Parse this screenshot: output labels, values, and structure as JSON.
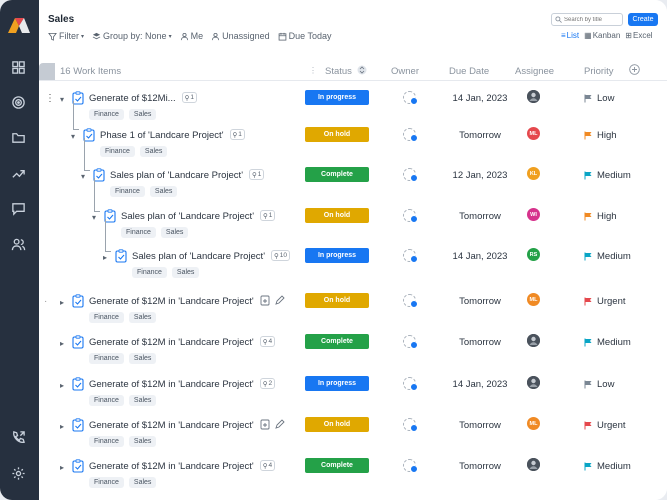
{
  "app": {
    "title": "Sales"
  },
  "toolbar": {
    "filter": "Filter",
    "group_by": "Group by: None",
    "me": "Me",
    "unassigned": "Unassigned",
    "due_today": "Due Today"
  },
  "search": {
    "placeholder": "Search by title"
  },
  "create_label": "Create",
  "views": {
    "list": "List",
    "kanban": "Kanban",
    "excel": "Excel"
  },
  "columns": {
    "work_items": "16 Work Items",
    "status": "Status",
    "owner": "Owner",
    "due_date": "Due Date",
    "assignee": "Assignee",
    "priority": "Priority"
  },
  "status_colors": {
    "In progress": "#1877f2",
    "On hold": "#e0a800",
    "Complete": "#24a148"
  },
  "priority_colors": {
    "Low": "#7b8794",
    "High": "#f08a24",
    "Medium": "#0aa5c5",
    "Urgent": "#e5484d"
  },
  "rows": [
    {
      "title": "Generate of $12Mi...",
      "subtasks": "1",
      "tags": [
        "Finance",
        "Sales"
      ],
      "status": "In progress",
      "due": "14 Jan, 2023",
      "assignee": {
        "initials": "",
        "color": "#3d4652",
        "photo": true
      },
      "priority": "Low"
    },
    {
      "title": "Phase 1 of 'Landcare Project'",
      "subtasks": "1",
      "tags": [
        "Finance",
        "Sales"
      ],
      "status": "On hold",
      "due": "Tomorrow",
      "assignee": {
        "initials": "ML",
        "color": "#e5484d"
      },
      "priority": "High"
    },
    {
      "title": "Sales plan of 'Landcare Project'",
      "subtasks": "1",
      "tags": [
        "Finance",
        "Sales"
      ],
      "status": "Complete",
      "due": "12 Jan, 2023",
      "assignee": {
        "initials": "KL",
        "color": "#f0a020"
      },
      "priority": "Medium"
    },
    {
      "title": "Sales plan of 'Landcare Project'",
      "subtasks": "1",
      "tags": [
        "Finance",
        "Sales"
      ],
      "status": "On hold",
      "due": "Tomorrow",
      "assignee": {
        "initials": "WI",
        "color": "#d6328c"
      },
      "priority": "High"
    },
    {
      "title": "Sales plan of 'Landcare Project'",
      "subtasks": "10",
      "tags": [
        "Finance",
        "Sales"
      ],
      "status": "In progress",
      "due": "14 Jan, 2023",
      "assignee": {
        "initials": "RS",
        "color": "#24a148"
      },
      "priority": "Medium"
    },
    {
      "title": "Generate of $12M in 'Landcare Project'",
      "subtasks": "",
      "tags": [
        "Finance",
        "Sales"
      ],
      "status": "On hold",
      "due": "Tomorrow",
      "assignee": {
        "initials": "ML",
        "color": "#f08a24"
      },
      "priority": "Urgent"
    },
    {
      "title": "Generate of $12M in 'Landcare Project'",
      "subtasks": "4",
      "tags": [
        "Finance",
        "Sales"
      ],
      "status": "Complete",
      "due": "Tomorrow",
      "assignee": {
        "initials": "",
        "color": "#3d4652",
        "photo": true
      },
      "priority": "Medium"
    },
    {
      "title": "Generate of $12M in 'Landcare Project'",
      "subtasks": "2",
      "tags": [
        "Finance",
        "Sales"
      ],
      "status": "In progress",
      "due": "14 Jan, 2023",
      "assignee": {
        "initials": "",
        "color": "#3d4652",
        "photo": true
      },
      "priority": "Low"
    },
    {
      "title": "Generate of $12M in 'Landcare Project'",
      "subtasks": "",
      "tags": [
        "Finance",
        "Sales"
      ],
      "status": "On hold",
      "due": "Tomorrow",
      "assignee": {
        "initials": "ML",
        "color": "#f08a24"
      },
      "priority": "Urgent"
    },
    {
      "title": "Generate of $12M in 'Landcare Project'",
      "subtasks": "4",
      "tags": [
        "Finance",
        "Sales"
      ],
      "status": "Complete",
      "due": "Tomorrow",
      "assignee": {
        "initials": "",
        "color": "#3d4652",
        "photo": true
      },
      "priority": "Medium"
    }
  ]
}
